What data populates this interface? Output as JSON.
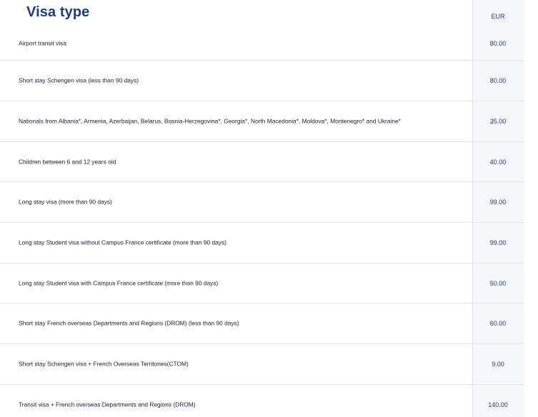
{
  "table": {
    "title": "Visa type",
    "currency_header": "EUR",
    "rows": [
      {
        "label": "Airport transit visa",
        "price": "80.00"
      },
      {
        "label": "Short stay Schengen visa (less than 90 days)",
        "price": "80.00"
      },
      {
        "label": "Nationals from Albania*, Armenia, Azerbaijan, Belarus, Bosnia-Herzegovina*, Georgia*, North Macedonia*, Moldova*, Montenegro* and Ukraine*",
        "price": "35.00"
      },
      {
        "label": "Children between 6 and 12 years old",
        "price": "40.00"
      },
      {
        "label": "Long stay visa (more than 90 days)",
        "price": "99.00"
      },
      {
        "label": "Long stay Student visa without Campus France certificate (more than 90 days)",
        "price": "99.00"
      },
      {
        "label": "Long stay Student visa with Campus France certificate (more than 90 days)",
        "price": "50.00"
      },
      {
        "label": "Short stay French overseas Departments and Regions (DROM) (less than 90 days)",
        "price": "60.00"
      },
      {
        "label": "Short stay Schengen visa + French Overseas Territories(CTOM)",
        "price": "9.00"
      },
      {
        "label": "Transit visa + French overseas Departments and Regions (DROM)",
        "price": "140.00"
      }
    ]
  },
  "colors": {
    "title": "#1f3a8a",
    "price": "#1f3a8a",
    "text": "#1d1d35",
    "divider": "#e3e5ea",
    "price_column_bg": "#f6f7fa"
  }
}
